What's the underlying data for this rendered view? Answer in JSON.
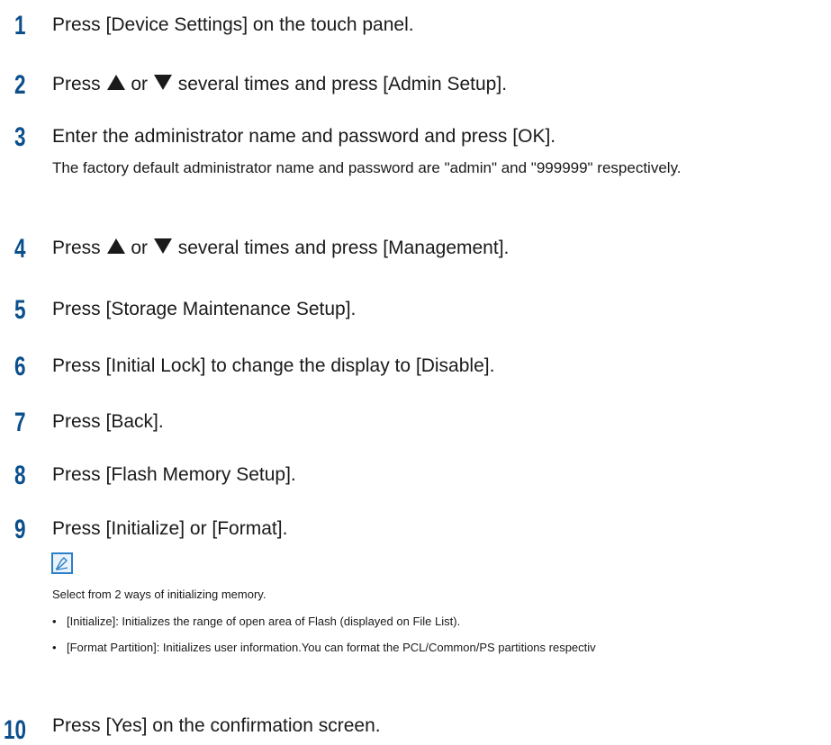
{
  "steps": [
    {
      "num": "1",
      "text": "Press [Device Settings] on the touch panel."
    },
    {
      "num": "2",
      "pre": "Press ",
      "mid": " or ",
      "post": " several times and press [Admin Setup]."
    },
    {
      "num": "3",
      "text": "Enter the administrator name and password and press [OK].",
      "sub": "The factory default administrator name and password are \"admin\" and \"999999\" respectively."
    },
    {
      "num": "4",
      "pre": "Press ",
      "mid": " or ",
      "post": " several times and press [Management]."
    },
    {
      "num": "5",
      "text": "Press [Storage Maintenance Setup]."
    },
    {
      "num": "6",
      "text": "Press [Initial Lock] to change the display to [Disable]."
    },
    {
      "num": "7",
      "text": "Press [Back]."
    },
    {
      "num": "8",
      "text": "Press [Flash Memory Setup]."
    },
    {
      "num": "9",
      "text": "Press [Initialize] or [Format]."
    },
    {
      "num": "10",
      "text": "Press [Yes] on the confirmation screen."
    }
  ],
  "note": {
    "icon": "memo-pencil-icon",
    "text": "Select from 2 ways of initializing memory.",
    "bullets": [
      "[Initialize]: Initializes the range of open area of Flash (displayed on File List).",
      "[Format Partition]: Initializes user information.You can format the PCL/Common/PS partitions respectiv"
    ]
  },
  "colors": {
    "step_number": "#0b4f8c",
    "note_icon_border": "#2a7fc9"
  }
}
